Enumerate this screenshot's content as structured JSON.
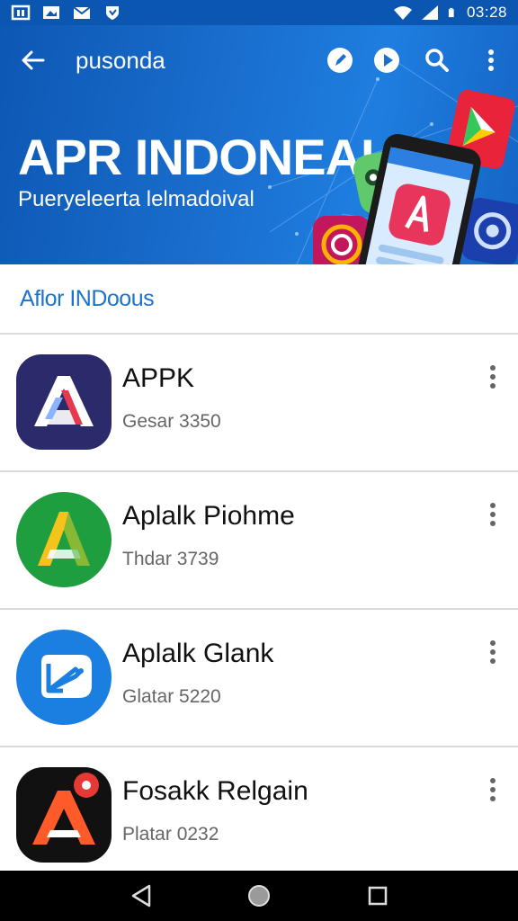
{
  "status_bar": {
    "time": "03:28",
    "left_icons": [
      "app-notification-icon",
      "image-notification-icon",
      "mail-notification-icon",
      "shield-notification-icon"
    ],
    "right_icons": [
      "wifi-icon",
      "signal-icon",
      "battery-icon"
    ]
  },
  "toolbar": {
    "title": "pusonda",
    "actions": [
      "pen-icon",
      "play-icon",
      "search-icon",
      "more-vert-icon"
    ]
  },
  "banner": {
    "title": "APR INDONEAI",
    "subtitle": "Pueryeleerta lelmadoival"
  },
  "section": {
    "title": "Aflor INDoous"
  },
  "apps": [
    {
      "name": "APPK",
      "subtitle": "Gesar 3350"
    },
    {
      "name": "Aplalk Piohme",
      "subtitle": "Thdar 3739"
    },
    {
      "name": "Aplalk Glank",
      "subtitle": "Glatar 5220"
    },
    {
      "name": "Fosakk Relgain",
      "subtitle": "Platar 0232"
    }
  ],
  "colors": {
    "header_blue": "#1a6fcf",
    "section_title": "#1b74c9",
    "nav_bar": "#000000"
  }
}
